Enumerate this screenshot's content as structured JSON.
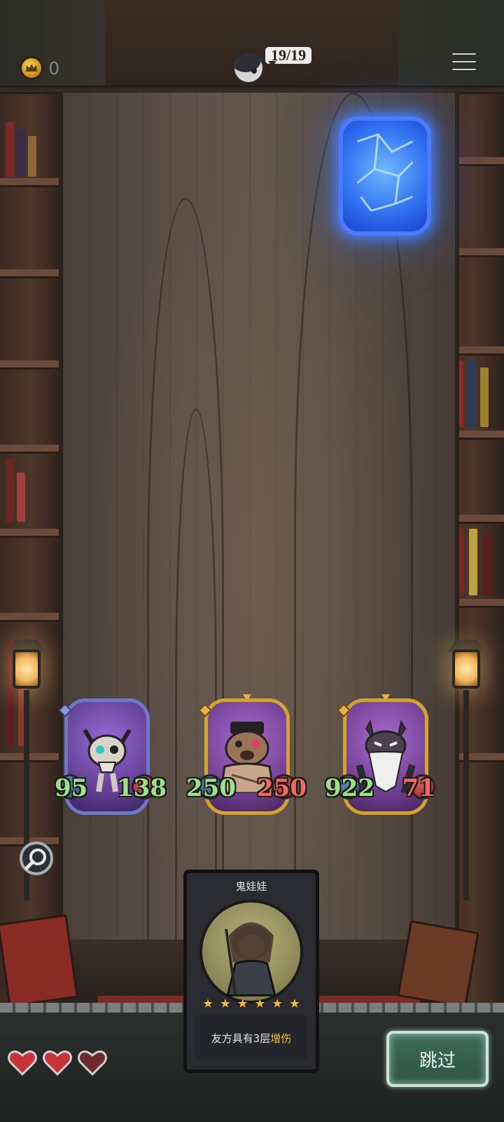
{
  "hud": {
    "coin_icon": "crown-coin-icon",
    "coin_count": "0",
    "player_hp": "19/19",
    "menu_icon": "hamburger-menu-icon"
  },
  "deck": {
    "icon": "blue-card-deck-icon"
  },
  "board_units": [
    {
      "attack": "95",
      "health": "138",
      "frame": "blue",
      "portrait": "horned-skull-monster-icon"
    },
    {
      "attack": "250",
      "health": "250",
      "frame": "gold",
      "portrait": "scarred-bear-mobster-icon"
    },
    {
      "attack": "922",
      "health": "71",
      "frame": "gold",
      "portrait": "bearded-cat-elder-icon"
    }
  ],
  "hand_card": {
    "name": "鬼娃娃",
    "stars": 6,
    "description_prefix": "友方具有3层",
    "description_keyword": "增伤"
  },
  "lives": {
    "total": 3,
    "filled": 2
  },
  "skip_button": {
    "label": "跳过"
  },
  "colors": {
    "attack_text": "#9fe08a",
    "health_text": "#f06a60",
    "keyword": "#f0c030",
    "deck_glow": "#2f6ff0",
    "skip_button": "#3f6a58"
  }
}
